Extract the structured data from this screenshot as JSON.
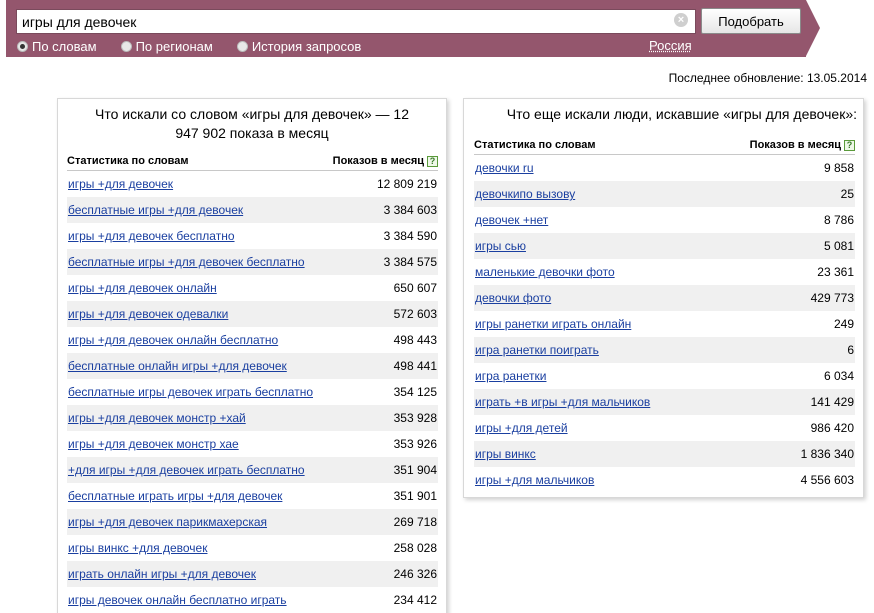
{
  "search": {
    "query": "игры для девочек",
    "submit_label": "Подобрать",
    "clear_glyph": "×",
    "modes": [
      {
        "label": "По словам",
        "checked": true
      },
      {
        "label": "По регионам",
        "checked": false
      },
      {
        "label": "История запросов",
        "checked": false
      }
    ],
    "region": "Россия"
  },
  "last_update": "Последнее обновление: 13.05.2014",
  "left_panel": {
    "title": "Что искали со словом «игры для девочек» — 12 947 902 показа в месяц",
    "col_keyword": "Статистика по словам",
    "col_count": "Показов в месяц",
    "help_glyph": "?",
    "rows": [
      {
        "keyword": "игры +для девочек",
        "count": "12 809 219"
      },
      {
        "keyword": "бесплатные игры +для девочек",
        "count": "3 384 603"
      },
      {
        "keyword": "игры +для девочек бесплатно",
        "count": "3 384 590"
      },
      {
        "keyword": "бесплатные игры +для девочек бесплатно",
        "count": "3 384 575"
      },
      {
        "keyword": "игры +для девочек онлайн",
        "count": "650 607"
      },
      {
        "keyword": "игры +для девочек одевалки",
        "count": "572 603"
      },
      {
        "keyword": "игры +для девочек онлайн бесплатно",
        "count": "498 443"
      },
      {
        "keyword": "бесплатные онлайн игры +для девочек",
        "count": "498 441"
      },
      {
        "keyword": "бесплатные игры девочек играть бесплатно",
        "count": "354 125"
      },
      {
        "keyword": "игры +для девочек монстр +хай",
        "count": "353 928"
      },
      {
        "keyword": "игры +для девочек монстр хае",
        "count": "353 926"
      },
      {
        "keyword": "+для игры +для девочек играть бесплатно",
        "count": "351 904"
      },
      {
        "keyword": "бесплатные играть игры +для девочек",
        "count": "351 901"
      },
      {
        "keyword": "игры +для девочек парикмахерская",
        "count": "269 718"
      },
      {
        "keyword": "игры винкс +для девочек",
        "count": "258 028"
      },
      {
        "keyword": "играть онлайн игры +для девочек",
        "count": "246 326"
      },
      {
        "keyword": "игры девочек онлайн бесплатно играть",
        "count": "234 412"
      }
    ]
  },
  "right_panel": {
    "title": "Что еще искали люди, искавшие «игры для девочек»:",
    "col_keyword": "Статистика по словам",
    "col_count": "Показов в месяц",
    "help_glyph": "?",
    "rows": [
      {
        "keyword": "девочки ru",
        "count": "9 858"
      },
      {
        "keyword": "девочкипо вызову",
        "count": "25"
      },
      {
        "keyword": "девочек +нет",
        "count": "8 786"
      },
      {
        "keyword": "игры сью",
        "count": "5 081"
      },
      {
        "keyword": "маленькие девочки фото",
        "count": "23 361"
      },
      {
        "keyword": "девочки фото",
        "count": "429 773"
      },
      {
        "keyword": "игры ранетки играть онлайн",
        "count": "249"
      },
      {
        "keyword": "игра ранетки поиграть",
        "count": "6"
      },
      {
        "keyword": "игра ранетки",
        "count": "6 034"
      },
      {
        "keyword": "играть +в игры +для мальчиков",
        "count": "141 429"
      },
      {
        "keyword": "игры +для детей",
        "count": "986 420"
      },
      {
        "keyword": "игры винкс",
        "count": "1 836 340"
      },
      {
        "keyword": "игры +для мальчиков",
        "count": "4 556 603"
      }
    ]
  }
}
